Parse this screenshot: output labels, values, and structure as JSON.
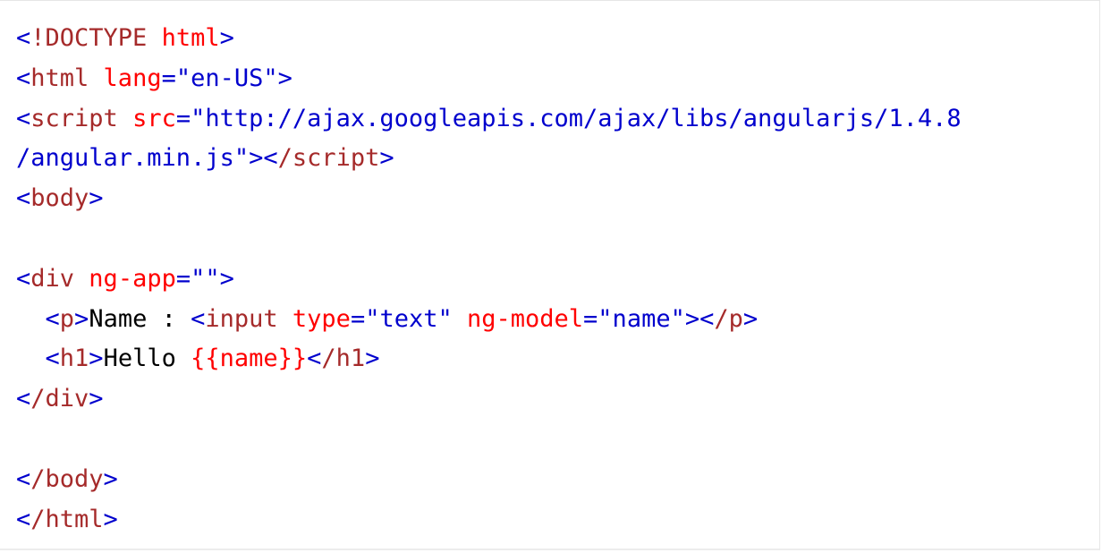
{
  "colors": {
    "punctuation": "#0000cd",
    "tag_name": "#a52a2a",
    "attr_name": "#ff0000",
    "attr_value": "#0000cd",
    "text": "#000000",
    "expression": "#ff0000"
  },
  "code_lines": [
    [
      {
        "t": "<",
        "c": "punctuation"
      },
      {
        "t": "!DOCTYPE",
        "c": "tag_name"
      },
      {
        "t": " html",
        "c": "attr_name"
      },
      {
        "t": ">",
        "c": "punctuation"
      }
    ],
    [
      {
        "t": "<",
        "c": "punctuation"
      },
      {
        "t": "html",
        "c": "tag_name"
      },
      {
        "t": " lang",
        "c": "attr_name"
      },
      {
        "t": "=\"en-US\"",
        "c": "attr_value"
      },
      {
        "t": ">",
        "c": "punctuation"
      }
    ],
    [
      {
        "t": "<",
        "c": "punctuation"
      },
      {
        "t": "script",
        "c": "tag_name"
      },
      {
        "t": " src",
        "c": "attr_name"
      },
      {
        "t": "=\"http://ajax.googleapis.com/ajax/libs/angularjs/1.4.8",
        "c": "attr_value"
      }
    ],
    [
      {
        "t": "/angular.min.js\"",
        "c": "attr_value"
      },
      {
        "t": "><",
        "c": "punctuation"
      },
      {
        "t": "/script",
        "c": "tag_name"
      },
      {
        "t": ">",
        "c": "punctuation"
      }
    ],
    [
      {
        "t": "<",
        "c": "punctuation"
      },
      {
        "t": "body",
        "c": "tag_name"
      },
      {
        "t": ">",
        "c": "punctuation"
      }
    ],
    [],
    [
      {
        "t": "<",
        "c": "punctuation"
      },
      {
        "t": "div",
        "c": "tag_name"
      },
      {
        "t": " ng-app",
        "c": "attr_name"
      },
      {
        "t": "=\"\"",
        "c": "attr_value"
      },
      {
        "t": ">",
        "c": "punctuation"
      }
    ],
    [
      {
        "t": "  ",
        "c": "text"
      },
      {
        "t": "<",
        "c": "punctuation"
      },
      {
        "t": "p",
        "c": "tag_name"
      },
      {
        "t": ">",
        "c": "punctuation"
      },
      {
        "t": "Name : ",
        "c": "text"
      },
      {
        "t": "<",
        "c": "punctuation"
      },
      {
        "t": "input",
        "c": "tag_name"
      },
      {
        "t": " type",
        "c": "attr_name"
      },
      {
        "t": "=\"text\"",
        "c": "attr_value"
      },
      {
        "t": " ng-model",
        "c": "attr_name"
      },
      {
        "t": "=\"name\"",
        "c": "attr_value"
      },
      {
        "t": "><",
        "c": "punctuation"
      },
      {
        "t": "/p",
        "c": "tag_name"
      },
      {
        "t": ">",
        "c": "punctuation"
      }
    ],
    [
      {
        "t": "  ",
        "c": "text"
      },
      {
        "t": "<",
        "c": "punctuation"
      },
      {
        "t": "h1",
        "c": "tag_name"
      },
      {
        "t": ">",
        "c": "punctuation"
      },
      {
        "t": "Hello ",
        "c": "text"
      },
      {
        "t": "{{name}}",
        "c": "expression"
      },
      {
        "t": "<",
        "c": "punctuation"
      },
      {
        "t": "/h1",
        "c": "tag_name"
      },
      {
        "t": ">",
        "c": "punctuation"
      }
    ],
    [
      {
        "t": "<",
        "c": "punctuation"
      },
      {
        "t": "/div",
        "c": "tag_name"
      },
      {
        "t": ">",
        "c": "punctuation"
      }
    ],
    [],
    [
      {
        "t": "<",
        "c": "punctuation"
      },
      {
        "t": "/body",
        "c": "tag_name"
      },
      {
        "t": ">",
        "c": "punctuation"
      }
    ],
    [
      {
        "t": "<",
        "c": "punctuation"
      },
      {
        "t": "/html",
        "c": "tag_name"
      },
      {
        "t": ">",
        "c": "punctuation"
      }
    ]
  ]
}
